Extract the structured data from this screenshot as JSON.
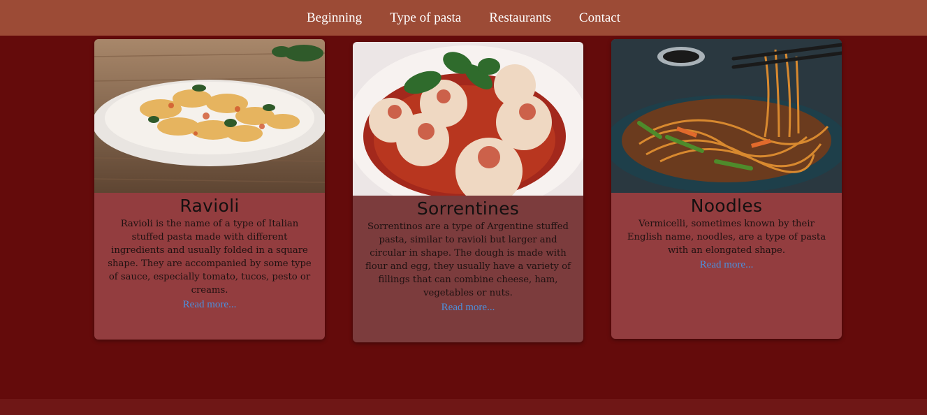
{
  "nav": {
    "items": [
      {
        "label": "Beginning"
      },
      {
        "label": "Type of pasta"
      },
      {
        "label": "Restaurants"
      },
      {
        "label": "Contact"
      }
    ]
  },
  "cards": [
    {
      "title": "Ravioli",
      "text": "Ravioli is the name of a type of Italian stuffed pasta made with different ingredients and usually folded in a square shape. They are accompanied by some type of sauce, especially tomato, tucos, pesto or creams.",
      "link": "Read more..."
    },
    {
      "title": "Sorrentines",
      "text": "Sorrentinos are a type of Argentine stuffed pasta, similar to ravioli but larger and circular in shape. The dough is made with flour and egg, they usually have a variety of fillings that can combine cheese, ham, vegetables or nuts.",
      "link": "Read more..."
    },
    {
      "title": "Noodles",
      "text": "Vermicelli, sometimes known by their English name, noodles, are a type of pasta with an elongated shape.",
      "link": "Read more..."
    }
  ]
}
